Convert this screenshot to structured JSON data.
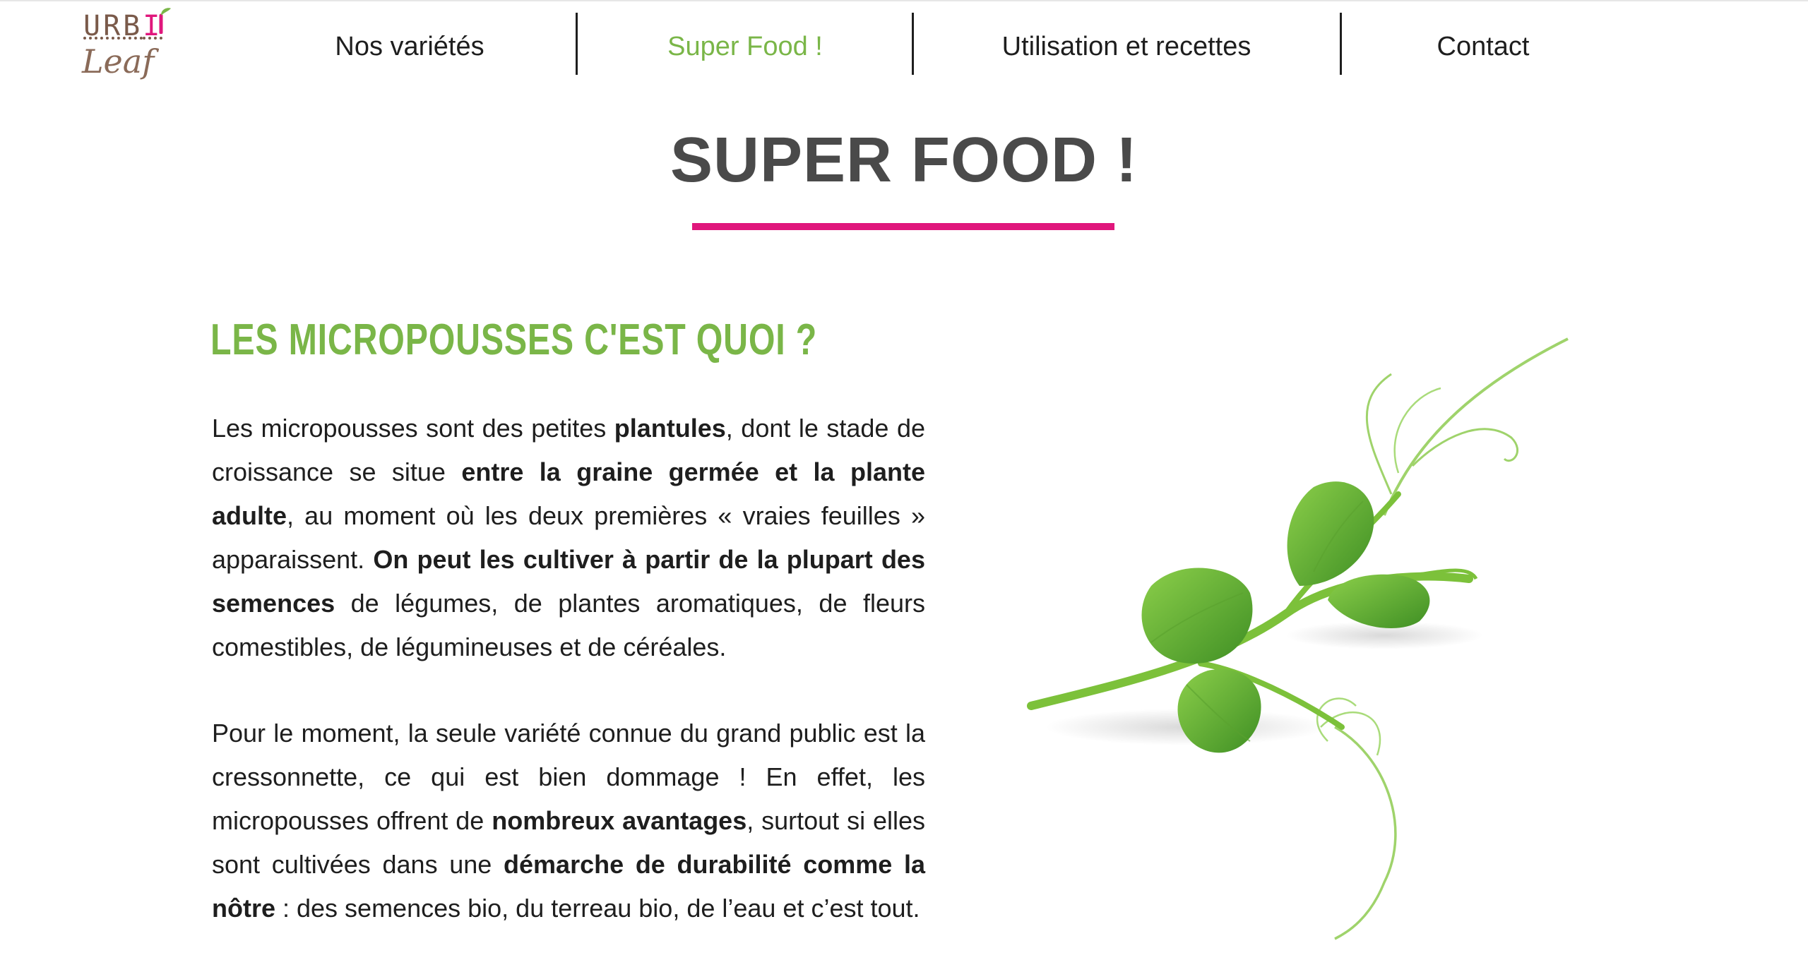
{
  "brand": {
    "logo_top": "URBI",
    "logo_bottom": "Leaf"
  },
  "nav": {
    "items": [
      {
        "label": "Nos variétés"
      },
      {
        "label": "Super Food !"
      },
      {
        "label": "Utilisation et recettes"
      },
      {
        "label": "Contact"
      }
    ],
    "active_index": 1
  },
  "page": {
    "title": "SUPER FOOD !",
    "section_heading": "LES MICROPOUSSES C'EST QUOI ?",
    "paragraph1": [
      {
        "text": "Les micropousses sont des petites ",
        "bold": false
      },
      {
        "text": "plantules",
        "bold": true
      },
      {
        "text": ", dont le stade de croissance se situe ",
        "bold": false
      },
      {
        "text": "entre la graine germée et la plante adulte",
        "bold": true
      },
      {
        "text": ", au moment où les deux premières « vraies feuilles » apparaissent. ",
        "bold": false
      },
      {
        "text": "On peut les cultiver à partir de la plupart des semences",
        "bold": true
      },
      {
        "text": " de légumes, de plantes aromatiques, de fleurs comestibles, de légumineuses et de céréales.",
        "bold": false
      }
    ],
    "paragraph2": [
      {
        "text": "Pour le moment, la seule variété connue du grand public est la cressonnette, ce qui est bien dommage ! En effet, les micropousses offrent de ",
        "bold": false
      },
      {
        "text": "nombreux avantages",
        "bold": true
      },
      {
        "text": ", surtout si elles sont cultivées dans une ",
        "bold": false
      },
      {
        "text": "démarche de durabilité comme la nôtre",
        "bold": true
      },
      {
        "text": " : des semences bio, du terreau bio, de l’eau et c’est tout.",
        "bold": false
      }
    ]
  },
  "colors": {
    "accent_green": "#7ab648",
    "accent_pink": "#e0177c",
    "title_gray": "#4a4a4a",
    "logo_brown": "#7a5a4a"
  },
  "icons": {
    "image": "pea-shoot-illustration"
  }
}
